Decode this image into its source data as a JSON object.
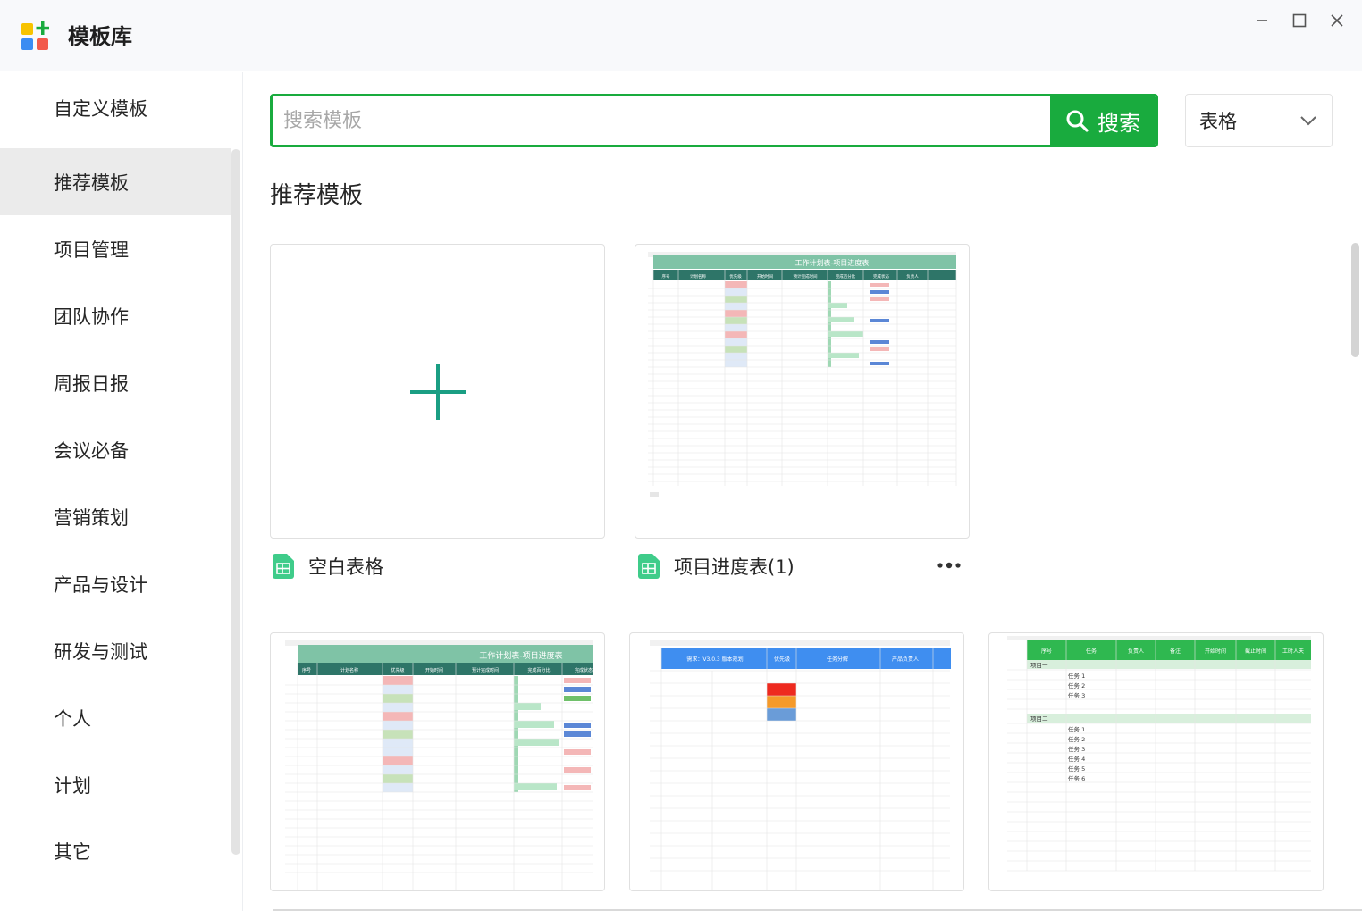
{
  "app": {
    "title": "模板库",
    "logo_icon": "template-library-logo-icon",
    "colors": {
      "yellow": "#f7c300",
      "green": "#19ab3e",
      "red": "#f25a4b",
      "blue": "#3b8cf2"
    }
  },
  "window_controls": [
    "minimize-icon",
    "maximize-icon",
    "close-icon"
  ],
  "sidebar": {
    "items": [
      {
        "label": "自定义模板",
        "active": false
      },
      {
        "label": "推荐模板",
        "active": true
      },
      {
        "label": "项目管理",
        "active": false
      },
      {
        "label": "团队协作",
        "active": false
      },
      {
        "label": "周报日报",
        "active": false
      },
      {
        "label": "会议必备",
        "active": false
      },
      {
        "label": "营销策划",
        "active": false
      },
      {
        "label": "产品与设计",
        "active": false
      },
      {
        "label": "研发与测试",
        "active": false
      },
      {
        "label": "个人",
        "active": false
      },
      {
        "label": "计划",
        "active": false
      },
      {
        "label": "其它",
        "active": false
      }
    ]
  },
  "search": {
    "placeholder": "搜索模板",
    "value": "",
    "button_label": "搜索",
    "button_icon": "search-icon",
    "accent": "#19ab3e"
  },
  "type_filter": {
    "selected": "表格",
    "icon": "chevron-down-icon"
  },
  "section": {
    "title": "推荐模板"
  },
  "templates": [
    {
      "name": "空白表格",
      "icon": "sheet-file-icon",
      "thumbnail": "plus-icon",
      "has_more": false
    },
    {
      "name": "项目进度表(1)",
      "icon": "sheet-file-icon",
      "thumbnail": "schedule-sheet",
      "has_more": true,
      "more_icon": "more-dots-icon"
    }
  ],
  "template_previews": {
    "schedule_title": "工作计划表-项目进度表",
    "schedule_headers": [
      "序号",
      "计划名称",
      "优先级",
      "开始时间",
      "预计完成时间",
      "完成百分比",
      "完成状态",
      "负责人"
    ],
    "requirements_title": "需求：V3.0.3 版本规划",
    "requirements_headers": [
      "优先级",
      "任务分解",
      "产品负责人"
    ],
    "task_headers": [
      "序号",
      "任务",
      "负责人",
      "备注",
      "开始时间",
      "截止时间",
      "工时人天"
    ],
    "task_groups": [
      "项目一",
      "项目二"
    ],
    "task_items_1": [
      "任务 1",
      "任务 2",
      "任务 3"
    ],
    "task_items_2": [
      "任务 1",
      "任务 2",
      "任务 3",
      "任务 4",
      "任务 5",
      "任务 6"
    ]
  }
}
